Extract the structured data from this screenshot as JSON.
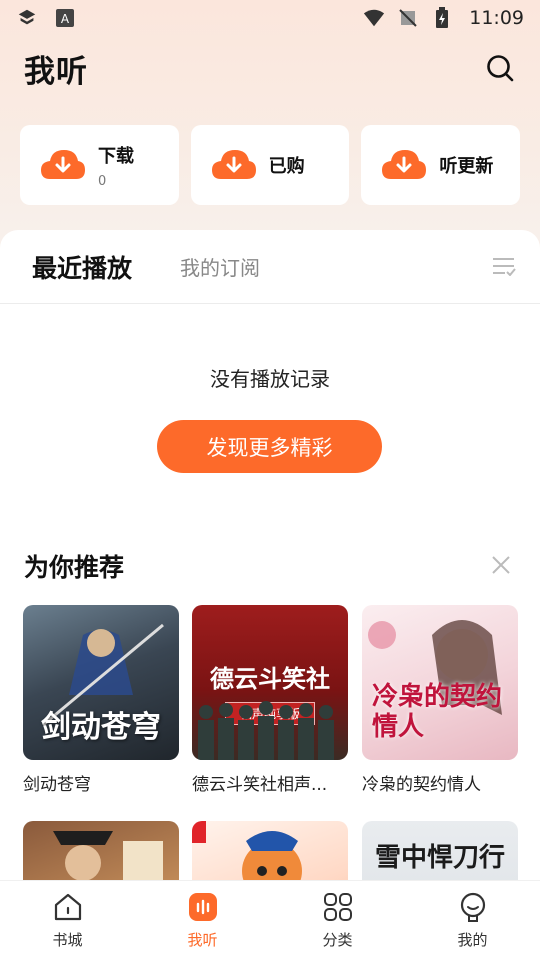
{
  "status": {
    "time": "11:09"
  },
  "header": {
    "title": "我听"
  },
  "quick": [
    {
      "label": "下载",
      "count": "0"
    },
    {
      "label": "已购",
      "count": ""
    },
    {
      "label": "听更新",
      "count": ""
    }
  ],
  "tabs": {
    "recent": "最近播放",
    "subscribed": "我的订阅"
  },
  "empty": {
    "message": "没有播放记录",
    "discover_label": "发现更多精彩"
  },
  "recommend": {
    "title": "为你推荐",
    "items": [
      {
        "name": "剑动苍穹",
        "cover_text": "剑动苍穹"
      },
      {
        "name": "德云斗笑社相声...",
        "cover_text": "德云斗笑社",
        "cover_sub": "相声纯享版"
      },
      {
        "name": "冷枭的契约情人",
        "cover_text": "冷枭的契约情人"
      },
      {
        "name": "",
        "cover_text": ""
      },
      {
        "name": "",
        "cover_text": ""
      },
      {
        "name": "",
        "cover_text": "雪中悍刀行"
      }
    ]
  },
  "nav": [
    {
      "label": "书城",
      "icon": "home-icon"
    },
    {
      "label": "我听",
      "icon": "listen-icon"
    },
    {
      "label": "分类",
      "icon": "category-icon"
    },
    {
      "label": "我的",
      "icon": "profile-icon"
    }
  ],
  "colors": {
    "accent": "#fd6a2a"
  }
}
